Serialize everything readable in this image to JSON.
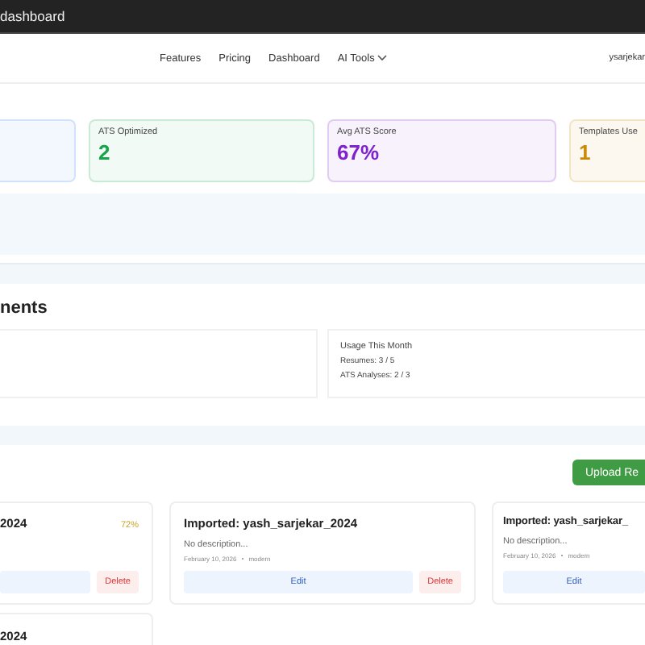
{
  "top_bar": {
    "title": "dashboard"
  },
  "nav": {
    "links": [
      {
        "label": "Features",
        "dropdown": false
      },
      {
        "label": "Pricing",
        "dropdown": false
      },
      {
        "label": "Dashboard",
        "dropdown": false
      },
      {
        "label": "AI Tools",
        "dropdown": true
      }
    ],
    "user": "ysarjekar"
  },
  "stats": [
    {
      "kind": "empty"
    },
    {
      "kind": "stat",
      "label": "ATS Optimized",
      "value": "2",
      "color": "#16a34a"
    },
    {
      "kind": "stat",
      "label": "Avg ATS Score",
      "value": "67%",
      "color": "#7e22ce"
    },
    {
      "kind": "stat",
      "label": "Templates Use",
      "value": "1",
      "color": "#ca8a04"
    }
  ],
  "usage_section": {
    "heading": "nents",
    "usage": {
      "title": "Usage This Month",
      "lines": [
        "Resumes: 3 / 5",
        "ATS Analyses: 2 / 3"
      ]
    }
  },
  "upload_button": {
    "label": "Upload Re"
  },
  "resumes": [
    {
      "title": "2024",
      "score": "72%",
      "actions": [
        {
          "kind": "edit"
        },
        {
          "kind": "delete",
          "label": "Delete"
        }
      ]
    },
    {
      "title": "Imported: yash_sarjekar_2024",
      "description": "No description...",
      "date": "February 10, 2026",
      "template": "modern",
      "actions": [
        {
          "kind": "edit",
          "label": "Edit"
        },
        {
          "kind": "delete",
          "label": "Delete"
        }
      ]
    },
    {
      "title": "Imported: yash_sarjekar_",
      "description": "No description...",
      "date": "February 10, 2026",
      "template": "modern",
      "actions": [
        {
          "kind": "edit",
          "label": "Edit"
        }
      ]
    },
    {
      "title": "2024"
    }
  ]
}
